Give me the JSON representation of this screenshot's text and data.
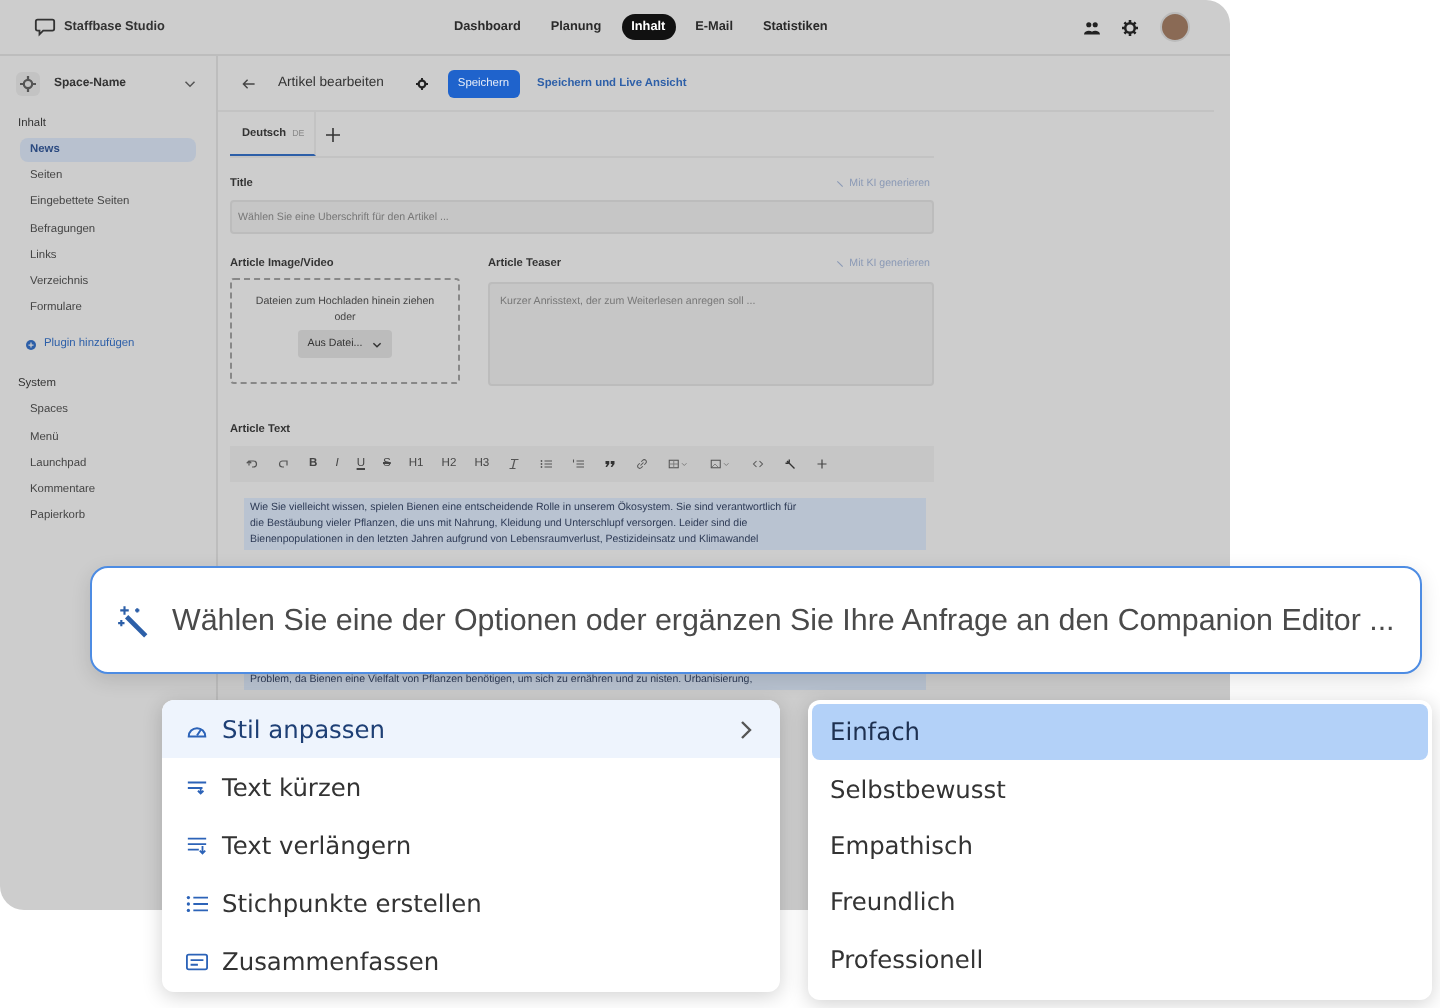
{
  "app_header": {
    "logo_text": "Staffbase Studio",
    "nav": [
      {
        "label": "Dashboard",
        "selected": false
      },
      {
        "label": "Planung",
        "selected": false
      },
      {
        "label": "Inhalt",
        "selected": true
      },
      {
        "label": "E-Mail",
        "selected": false
      },
      {
        "label": "Statistiken",
        "selected": false
      }
    ]
  },
  "sidebar": {
    "space_name": "Space-Name",
    "content_title": "Inhalt",
    "content_items": [
      {
        "label": "News",
        "selected": true
      },
      {
        "label": "Seiten",
        "selected": false
      },
      {
        "label": "Eingebettete Seiten",
        "selected": false
      },
      {
        "label": "Befragungen",
        "selected": false
      },
      {
        "label": "Links",
        "selected": false
      },
      {
        "label": "Verzeichnis",
        "selected": false
      },
      {
        "label": "Formulare",
        "selected": false
      }
    ],
    "plugin_link": "Plugin hinzufügen",
    "system_title": "System",
    "system_items": [
      {
        "label": "Spaces",
        "selected": false
      },
      {
        "label": "Menü",
        "selected": false
      },
      {
        "label": "Launchpad",
        "selected": false
      },
      {
        "label": "Kommentare",
        "selected": false
      },
      {
        "label": "Papierkorb",
        "selected": false
      }
    ]
  },
  "editor": {
    "title": "Artikel bearbeiten",
    "save_button": "Speichern",
    "live_link": "Speichern und Live Ansicht",
    "tabs": [
      {
        "label": "Deutsch",
        "code": "DE",
        "selected": true
      }
    ],
    "title_label": "Title",
    "title_ai_link": "Mit KI generieren",
    "title_placeholder": "Wählen Sie eine Überschrift für den Artikel ...",
    "image_label": "Article Image/Video",
    "dropzone_text": "Dateien zum Hochladen hinein ziehen oder",
    "file_button": "Aus Datei...",
    "teaser_label": "Article Teaser",
    "teaser_ai_link": "Mit KI generieren",
    "teaser_placeholder": "Kurzer Anrisstext, der zum Weiterlesen anregen soll ...",
    "text_label": "Article Text",
    "toolbar_labels": [
      "B",
      "I",
      "U",
      "S",
      "H1",
      "H2",
      "H3"
    ],
    "body_lines": [
      "Wie Sie vielleicht wissen, spielen Bienen eine entscheidende Rolle in unserem Ökosystem. Sie sind verantwortlich für",
      "die Bestäubung vieler Pflanzen, die uns mit Nahrung, Kleidung und Unterschlupf versorgen. Leider sind die",
      "Bienenpopulationen in den letzten Jahren aufgrund von Lebensraumverlust, Pestizideinsatz und Klimawandel"
    ],
    "body_lines_lower": [
      "Problem, da Bienen eine Vielfalt von Pflanzen benötigen, um sich zu ernähren und zu nisten. Urbanisierung,"
    ]
  },
  "prompt": {
    "placeholder": "Wählen Sie eine der Optionen oder ergänzen Sie Ihre Anfrage an den Companion Editor ..."
  },
  "menu": [
    {
      "kind": "style",
      "label": "Stil anpassen",
      "selected": true,
      "submenu": true
    },
    {
      "kind": "shorten",
      "label": "Text kürzen",
      "selected": false,
      "submenu": false
    },
    {
      "kind": "lengthen",
      "label": "Text verlängern",
      "selected": false,
      "submenu": false
    },
    {
      "kind": "bullets",
      "label": "Stichpunkte erstellen",
      "selected": false,
      "submenu": false
    },
    {
      "kind": "summary",
      "label": "Zusammenfassen",
      "selected": false,
      "submenu": false
    }
  ],
  "submenu": [
    {
      "label": "Einfach",
      "selected": true
    },
    {
      "label": "Selbstbewusst",
      "selected": false
    },
    {
      "label": "Empathisch",
      "selected": false
    },
    {
      "label": "Freundlich",
      "selected": false
    },
    {
      "label": "Professionell",
      "selected": false
    }
  ]
}
